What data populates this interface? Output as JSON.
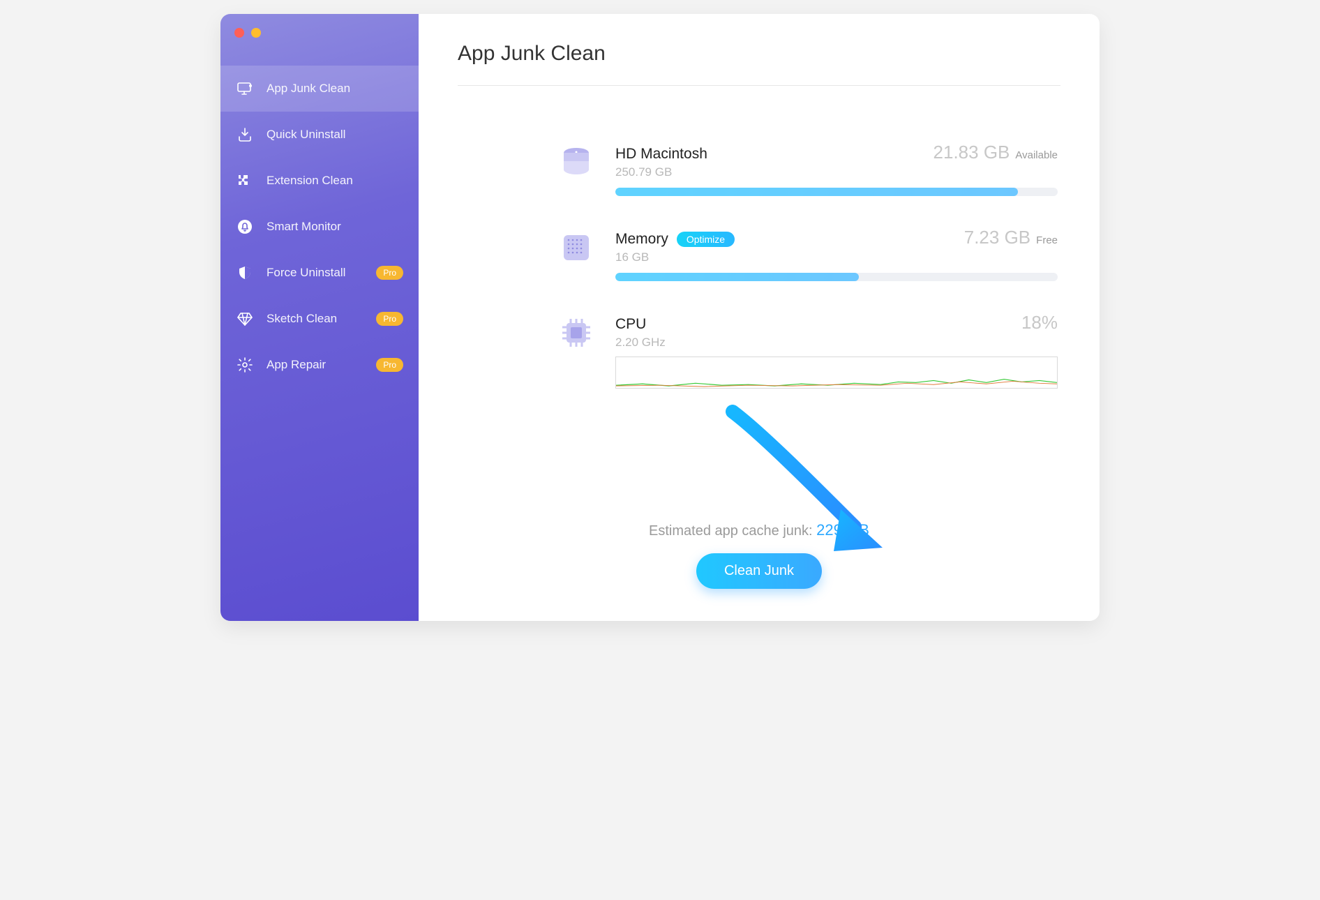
{
  "sidebar": {
    "items": [
      {
        "label": "App Junk Clean",
        "icon": "monitor-clean-icon",
        "pro": false,
        "active": true
      },
      {
        "label": "Quick Uninstall",
        "icon": "download-box-icon",
        "pro": false,
        "active": false
      },
      {
        "label": "Extension Clean",
        "icon": "puzzle-icon",
        "pro": false,
        "active": false
      },
      {
        "label": "Smart Monitor",
        "icon": "bell-icon",
        "pro": false,
        "active": false
      },
      {
        "label": "Force Uninstall",
        "icon": "shield-icon",
        "pro": true,
        "active": false
      },
      {
        "label": "Sketch Clean",
        "icon": "diamond-icon",
        "pro": true,
        "active": false
      },
      {
        "label": "App Repair",
        "icon": "gear-icon",
        "pro": true,
        "active": false
      }
    ],
    "pro_label": "Pro"
  },
  "page": {
    "title": "App Junk Clean"
  },
  "disk": {
    "name": "HD Macintosh",
    "total": "250.79 GB",
    "value": "21.83 GB",
    "value_label": "Available",
    "used_pct": 91
  },
  "memory": {
    "name": "Memory",
    "optimize_label": "Optimize",
    "total": "16 GB",
    "value": "7.23 GB",
    "value_label": "Free",
    "used_pct": 55
  },
  "cpu": {
    "name": "CPU",
    "freq": "2.20 GHz",
    "pct": "18%"
  },
  "estimate": {
    "prefix": "Estimated app cache junk: ",
    "value": "229 MB"
  },
  "actions": {
    "clean_label": "Clean Junk"
  },
  "colors": {
    "accent_blue": "#2aa7ff",
    "sidebar_top": "#8f8be0",
    "sidebar_bottom": "#5b4dd0",
    "pro_badge": "#f7b731"
  }
}
